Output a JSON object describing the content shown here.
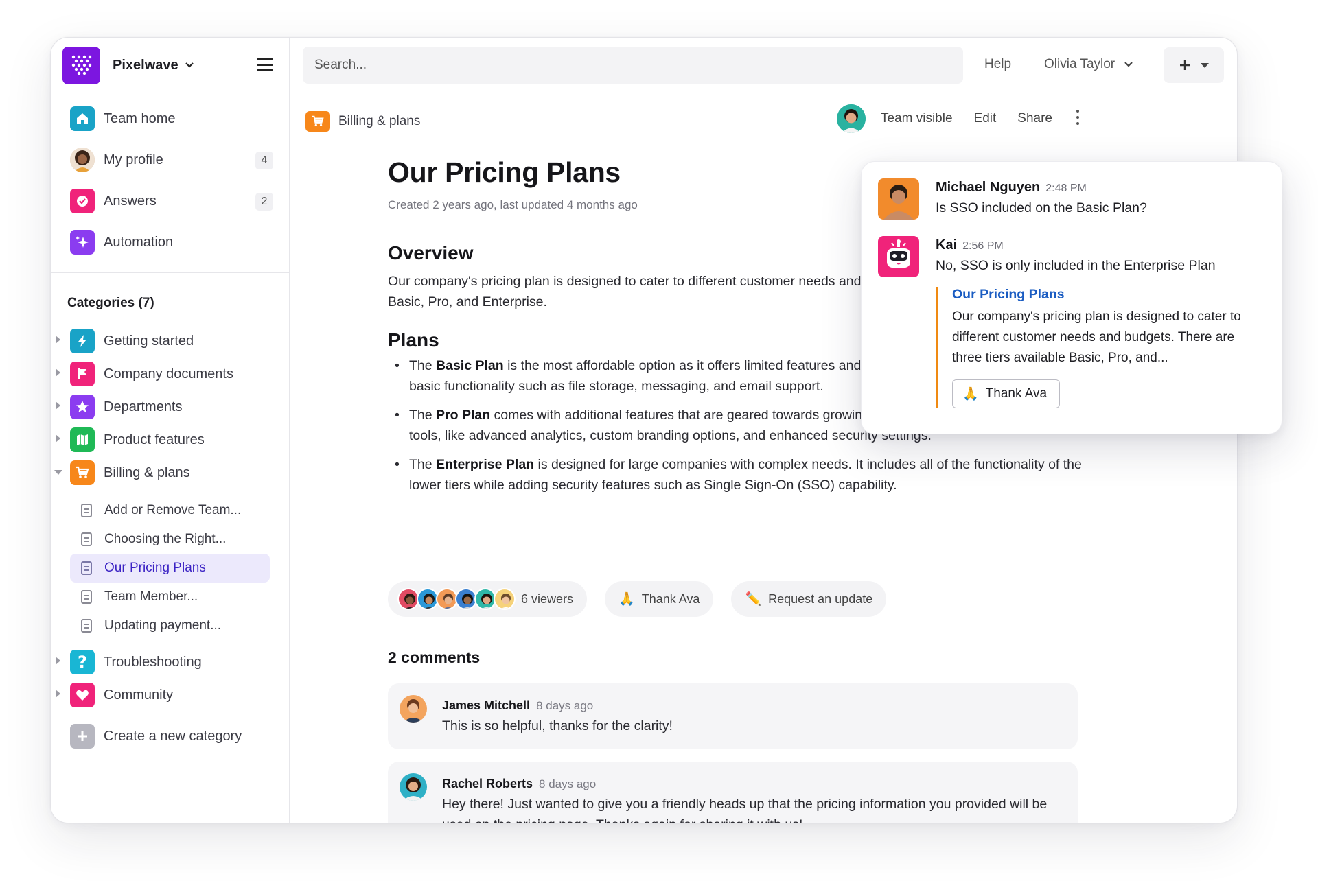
{
  "workspace": {
    "name": "Pixelwave"
  },
  "nav": [
    {
      "label": "Team home",
      "icon": "home-icon",
      "color": "#19a3c7"
    },
    {
      "label": "My profile",
      "icon": "avatar",
      "count": "4"
    },
    {
      "label": "Answers",
      "icon": "check-circle-icon",
      "color": "#f0237a",
      "count": "2"
    },
    {
      "label": "Automation",
      "icon": "sparkle-icon",
      "color": "#8b3cf0"
    }
  ],
  "categories": {
    "title": "Categories (7)",
    "items": [
      {
        "label": "Getting started",
        "icon": "bolt-icon",
        "color": "#19a3c7"
      },
      {
        "label": "Company documents",
        "icon": "flag-icon",
        "color": "#f0237a"
      },
      {
        "label": "Departments",
        "icon": "star-icon",
        "color": "#8b3cf0"
      },
      {
        "label": "Product features",
        "icon": "map-icon",
        "color": "#1fb956"
      },
      {
        "label": "Billing & plans",
        "icon": "cart-icon",
        "color": "#f7871a"
      }
    ],
    "billing_docs": [
      "Add or Remove Team...",
      "Choosing the Right...",
      "Our Pricing Plans",
      "Team Member...",
      "Updating payment..."
    ],
    "more": [
      {
        "label": "Troubleshooting",
        "icon": "question-icon",
        "color": "#19a3c7"
      },
      {
        "label": "Community",
        "icon": "heart-icon",
        "color": "#f0237a"
      }
    ],
    "create": "Create a new category"
  },
  "topbar": {
    "search_placeholder": "Search...",
    "help": "Help",
    "user": "Olivia Taylor"
  },
  "page": {
    "breadcrumb": "Billing & plans",
    "actions": {
      "visibility": "Team visible",
      "edit": "Edit",
      "share": "Share"
    },
    "title": "Our Pricing Plans",
    "meta": "Created 2 years ago, last updated 4 months ago",
    "overview_heading": "Overview",
    "overview_text": "Our company's pricing plan is designed to cater to different customer needs and budgets. There are three tiers available - Basic, Pro, and Enterprise.",
    "plans_heading": "Plans",
    "plans": [
      {
        "pre": "The ",
        "bold": "Basic Plan",
        "post": " is the most affordable option as it offers limited features and customization options. This tier includes basic functionality such as file storage, messaging, and email support."
      },
      {
        "pre": "The ",
        "bold": "Pro Plan",
        "post": " comes with additional features that are geared towards growing teams, including advanced productivity tools, like advanced analytics, custom branding options, and enhanced security settings."
      },
      {
        "pre": "The ",
        "bold": "Enterprise Plan",
        "post": " is designed for large companies with complex needs. It includes all of the functionality of the lower tiers while adding security features such as Single Sign-On (SSO) capability."
      }
    ],
    "viewers": "6 viewers",
    "thank": "Thank Ava",
    "request": "Request an update",
    "comments_heading": "2 comments",
    "comments": [
      {
        "name": "James Mitchell",
        "time": "8 days ago",
        "text": "This is so helpful, thanks for the clarity!"
      },
      {
        "name": "Rachel Roberts",
        "time": "8 days ago",
        "text": "Hey there! Just wanted to give you a friendly heads up that the pricing information you provided will be used on the pricing page. Thanks again for sharing it with us!"
      }
    ]
  },
  "chat": {
    "question": {
      "name": "Michael Nguyen",
      "time": "2:48 PM",
      "text": "Is SSO included on the Basic Plan?"
    },
    "answer": {
      "name": "Kai",
      "time": "2:56 PM",
      "text": "No, SSO is only included in the Enterprise Plan"
    },
    "quote_title": "Our Pricing Plans",
    "quote_text": "Our company's pricing plan is designed to cater to different customer needs and budgets. There are three tiers available Basic, Pro, and...",
    "thank_button": "Thank Ava"
  }
}
